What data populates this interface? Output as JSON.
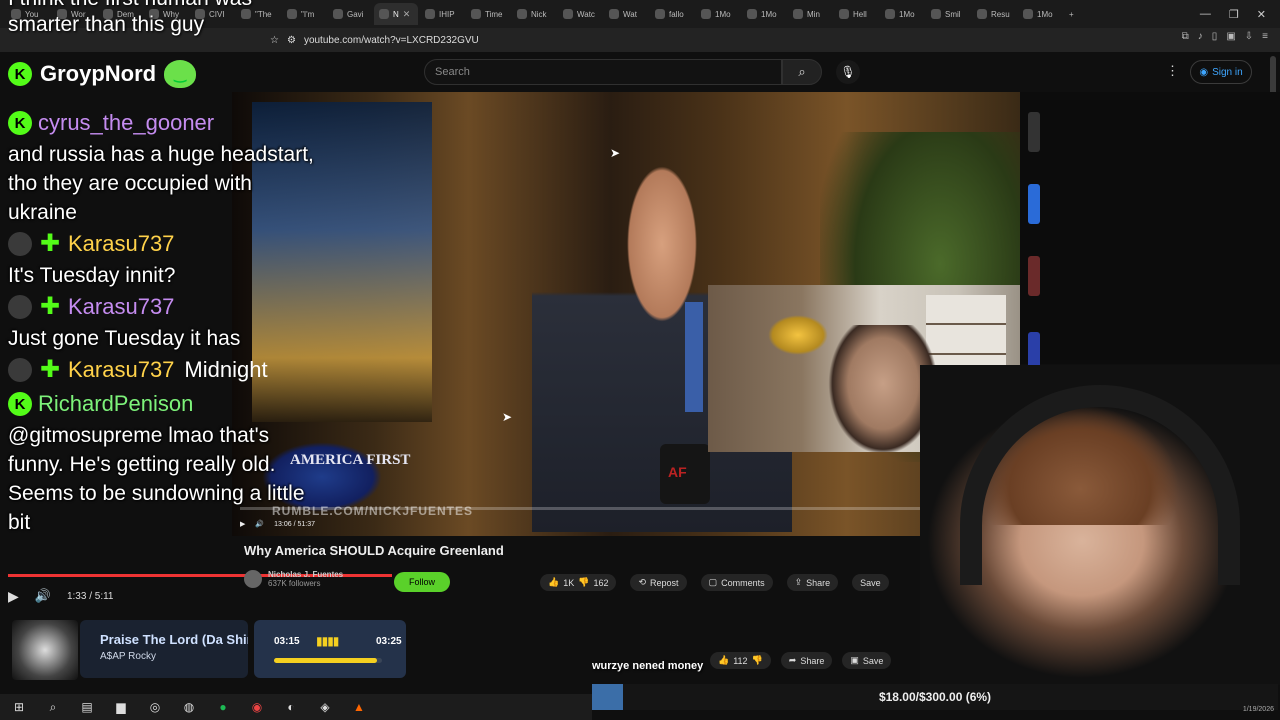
{
  "browser": {
    "tabs": [
      {
        "label": "You"
      },
      {
        "label": "Wor"
      },
      {
        "label": "Dem"
      },
      {
        "label": "Why"
      },
      {
        "label": "CIVI"
      },
      {
        "label": "\"The"
      },
      {
        "label": "\"I'm"
      },
      {
        "label": "Gavi"
      },
      {
        "label": "N",
        "active": true
      },
      {
        "label": "IHIP"
      },
      {
        "label": "Time"
      },
      {
        "label": "Nick"
      },
      {
        "label": "Watc"
      },
      {
        "label": "Wat"
      },
      {
        "label": "fallo"
      },
      {
        "label": "1Mo"
      },
      {
        "label": "1Mo"
      },
      {
        "label": "Min"
      },
      {
        "label": "Hell"
      },
      {
        "label": "1Mo"
      },
      {
        "label": "Smil"
      },
      {
        "label": "Resu"
      },
      {
        "label": "1Mo"
      }
    ],
    "new_tab_label": "+",
    "url": "youtube.com/watch?v=LXCRD232GVU"
  },
  "youtube": {
    "search_placeholder": "Search",
    "sign_in": "Sign in"
  },
  "overlay": {
    "top_caption_line1": "I think the first human was",
    "top_caption_line2": "smarter than this guy",
    "channel_name": "GroypNord"
  },
  "chat": [
    {
      "user": "cyrus_the_gooner",
      "color": "purple",
      "badge": "kick",
      "message_lines": [
        "and russia has a huge headstart,",
        "tho they are occupied with",
        "ukraine"
      ]
    },
    {
      "user": "Karasu737",
      "color": "gold",
      "badge": "sub",
      "message_lines": [
        "It's Tuesday innit?"
      ]
    },
    {
      "user": "Karasu737",
      "color": "purple",
      "badge": "sub",
      "message_lines": [
        "Just gone Tuesday it has"
      ]
    },
    {
      "user": "Karasu737",
      "color": "gold",
      "badge": "sub",
      "inline_message": "Midnight"
    },
    {
      "user": "RichardPenison",
      "color": "green",
      "badge": "kick",
      "message_lines": [
        "@gitmosupreme lmao that's",
        "funny. He's getting really old.",
        "Seems to be sundowning a little",
        "bit"
      ]
    }
  ],
  "video": {
    "cap_text": "AMERICA FIRST",
    "mug_logo": "AF",
    "watermark": "RUMBLE.COM/NICKJFUENTES",
    "inner_time": "13:06 / 51:37",
    "inner_title": "Why America SHOULD Acquire Greenland",
    "inner_channel": "Nicholas J. Fuentes",
    "inner_followers": "637K followers",
    "follow": "Follow",
    "likes": "1K",
    "dislikes": "162",
    "repost": "Repost",
    "comments": "Comments",
    "share": "Share",
    "save": "Save"
  },
  "player": {
    "time": "1:33 / 5:11",
    "progress_fraction": 0.3
  },
  "page_actions": {
    "likes": "112",
    "share": "Share",
    "save": "Save"
  },
  "now_playing": {
    "title": "Praise The Lord (Da Shine)",
    "artist": "A$AP Rocky",
    "current": "03:15",
    "total": "03:25",
    "progress_fraction": 0.95
  },
  "donation": {
    "donor_message": "wurzye nened money",
    "goal_text": "$18.00/$300.00 (6%)",
    "goal_fraction": 0.06
  },
  "taskbar": {
    "date": "1/19/2026"
  },
  "colors": {
    "kick_green": "#53fc18",
    "goal_blue": "#3b6ea8",
    "np_yellow": "#f5d020"
  }
}
